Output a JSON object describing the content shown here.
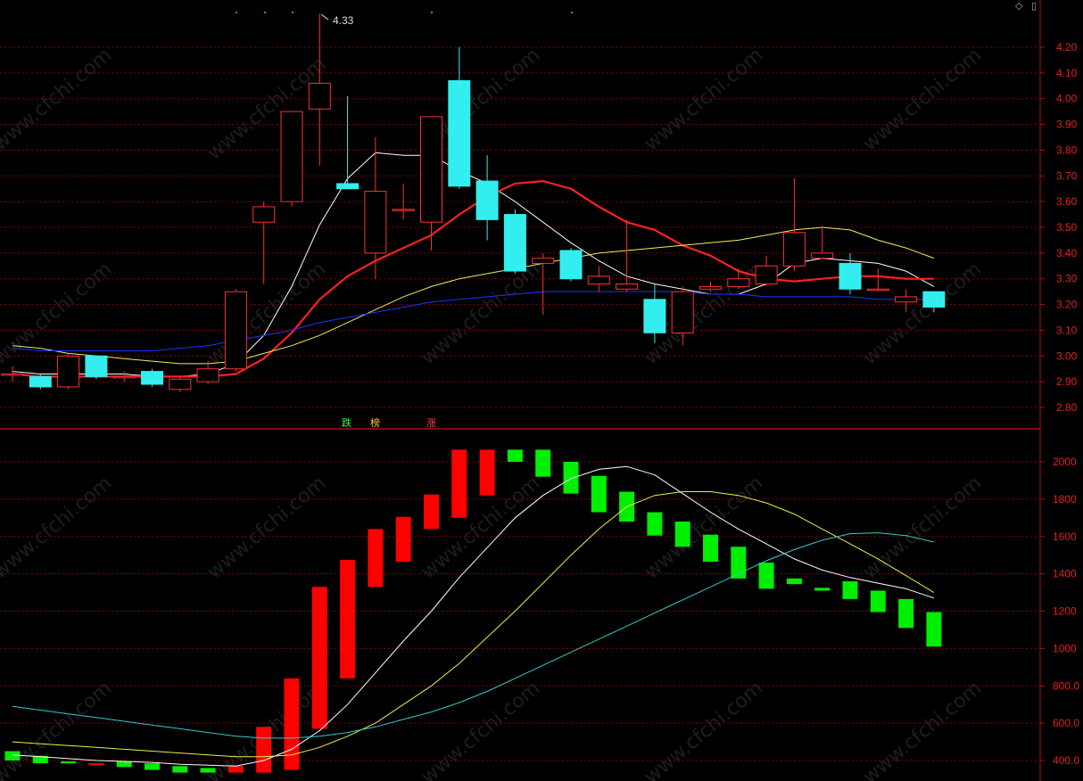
{
  "toolbar": {
    "diamond_icon": "◇",
    "window_icon": "▯"
  },
  "price_panel": {
    "peak_label": "4.33",
    "axis_ticks": [
      "4.20",
      "4.10",
      "4.00",
      "3.90",
      "3.80",
      "3.70",
      "3.60",
      "3.50",
      "3.40",
      "3.30",
      "3.20",
      "3.10",
      "3.00",
      "2.90",
      "2.80"
    ],
    "markers": [
      {
        "text": "跌",
        "color": "#33ff33"
      },
      {
        "text": "榜",
        "color": "#ffcc33"
      },
      {
        "text": "涨",
        "color": "#ff4444"
      }
    ]
  },
  "volume_panel": {
    "axis_ticks": [
      "2000",
      "1800",
      "1600",
      "1400",
      "1200",
      "1000",
      "800.0",
      "600.0",
      "400.0"
    ]
  },
  "watermark": "www.cfchi.com",
  "colors": {
    "up": "#ff3030",
    "down": "#33eeee",
    "vol_up": "#ff0000",
    "vol_down": "#00ee00",
    "ma5": "#ffffff",
    "ma10": "#ff2020",
    "ma20": "#eeee55",
    "ma60": "#2233ff",
    "vma5": "#ffffff",
    "vma10": "#eeee44",
    "vma20": "#33cccc",
    "grid": "#8b0000"
  },
  "chart_data": [
    {
      "type": "candlestick",
      "ylim": [
        2.75,
        4.33
      ],
      "candles": [
        {
          "o": 2.93,
          "h": 2.96,
          "l": 2.9,
          "c": 2.93
        },
        {
          "o": 2.92,
          "h": 2.93,
          "l": 2.87,
          "c": 2.88
        },
        {
          "o": 2.88,
          "h": 3.01,
          "l": 2.87,
          "c": 3.0
        },
        {
          "o": 3.0,
          "h": 3.0,
          "l": 2.91,
          "c": 2.92
        },
        {
          "o": 2.92,
          "h": 2.94,
          "l": 2.9,
          "c": 2.92
        },
        {
          "o": 2.94,
          "h": 2.95,
          "l": 2.88,
          "c": 2.89
        },
        {
          "o": 2.87,
          "h": 2.92,
          "l": 2.86,
          "c": 2.91
        },
        {
          "o": 2.9,
          "h": 2.98,
          "l": 2.89,
          "c": 2.95
        },
        {
          "o": 2.95,
          "h": 3.26,
          "l": 2.94,
          "c": 3.25
        },
        {
          "o": 3.52,
          "h": 3.6,
          "l": 3.28,
          "c": 3.58
        },
        {
          "o": 3.6,
          "h": 3.95,
          "l": 3.58,
          "c": 3.95
        },
        {
          "o": 3.96,
          "h": 4.33,
          "l": 3.74,
          "c": 4.06
        },
        {
          "o": 3.67,
          "h": 4.01,
          "l": 3.66,
          "c": 3.65
        },
        {
          "o": 3.4,
          "h": 3.85,
          "l": 3.3,
          "c": 3.64
        },
        {
          "o": 3.57,
          "h": 3.67,
          "l": 3.53,
          "c": 3.57
        },
        {
          "o": 3.52,
          "h": 3.93,
          "l": 3.41,
          "c": 3.93
        },
        {
          "o": 4.07,
          "h": 4.2,
          "l": 3.65,
          "c": 3.66
        },
        {
          "o": 3.68,
          "h": 3.78,
          "l": 3.45,
          "c": 3.53
        },
        {
          "o": 3.55,
          "h": 3.57,
          "l": 3.32,
          "c": 3.33
        },
        {
          "o": 3.36,
          "h": 3.4,
          "l": 3.16,
          "c": 3.38
        },
        {
          "o": 3.41,
          "h": 3.42,
          "l": 3.29,
          "c": 3.3
        },
        {
          "o": 3.28,
          "h": 3.35,
          "l": 3.25,
          "c": 3.31
        },
        {
          "o": 3.26,
          "h": 3.53,
          "l": 3.25,
          "c": 3.28
        },
        {
          "o": 3.22,
          "h": 3.28,
          "l": 3.05,
          "c": 3.09
        },
        {
          "o": 3.09,
          "h": 3.27,
          "l": 3.04,
          "c": 3.25
        },
        {
          "o": 3.26,
          "h": 3.29,
          "l": 3.25,
          "c": 3.27
        },
        {
          "o": 3.27,
          "h": 3.34,
          "l": 3.26,
          "c": 3.3
        },
        {
          "o": 3.28,
          "h": 3.39,
          "l": 3.27,
          "c": 3.35
        },
        {
          "o": 3.35,
          "h": 3.69,
          "l": 3.33,
          "c": 3.48
        },
        {
          "o": 3.38,
          "h": 3.5,
          "l": 3.38,
          "c": 3.4
        },
        {
          "o": 3.36,
          "h": 3.4,
          "l": 3.24,
          "c": 3.26
        },
        {
          "o": 3.26,
          "h": 3.34,
          "l": 3.25,
          "c": 3.26
        },
        {
          "o": 3.21,
          "h": 3.26,
          "l": 3.17,
          "c": 3.23
        },
        {
          "o": 3.25,
          "h": 3.25,
          "l": 3.17,
          "c": 3.19
        }
      ],
      "ma_lines": [
        {
          "name": "MA5",
          "values": [
            2.94,
            2.93,
            2.93,
            2.93,
            2.93,
            2.92,
            2.92,
            2.93,
            2.97,
            3.08,
            3.27,
            3.51,
            3.69,
            3.79,
            3.78,
            3.78,
            3.72,
            3.67,
            3.6,
            3.52,
            3.44,
            3.37,
            3.31,
            3.28,
            3.26,
            3.24,
            3.24,
            3.28,
            3.36,
            3.38,
            3.37,
            3.36,
            3.33,
            3.27
          ]
        },
        {
          "name": "MA10",
          "values": [
            2.93,
            2.92,
            2.92,
            2.92,
            2.92,
            2.92,
            2.92,
            2.92,
            2.93,
            2.99,
            3.09,
            3.22,
            3.31,
            3.37,
            3.42,
            3.47,
            3.55,
            3.62,
            3.67,
            3.68,
            3.65,
            3.58,
            3.52,
            3.49,
            3.43,
            3.39,
            3.33,
            3.3,
            3.29,
            3.3,
            3.31,
            3.31,
            3.3,
            3.3
          ]
        },
        {
          "name": "MA20",
          "values": [
            3.04,
            3.03,
            3.01,
            3.0,
            2.99,
            2.98,
            2.97,
            2.97,
            2.98,
            3.01,
            3.04,
            3.08,
            3.13,
            3.18,
            3.23,
            3.27,
            3.3,
            3.32,
            3.34,
            3.36,
            3.38,
            3.4,
            3.41,
            3.42,
            3.43,
            3.44,
            3.45,
            3.47,
            3.49,
            3.5,
            3.49,
            3.45,
            3.42,
            3.38
          ]
        },
        {
          "name": "MA60",
          "values": [
            3.03,
            3.02,
            3.02,
            3.02,
            3.02,
            3.02,
            3.03,
            3.04,
            3.06,
            3.08,
            3.1,
            3.13,
            3.15,
            3.17,
            3.19,
            3.21,
            3.22,
            3.23,
            3.24,
            3.25,
            3.25,
            3.25,
            3.25,
            3.25,
            3.25,
            3.24,
            3.24,
            3.23,
            3.23,
            3.23,
            3.23,
            3.22,
            3.22,
            3.22
          ]
        }
      ]
    },
    {
      "type": "bar",
      "ylim": [
        330,
        2170
      ],
      "bars": [
        {
          "lo": 400,
          "hi": 450,
          "dir": "down"
        },
        {
          "lo": 385,
          "hi": 425,
          "dir": "down"
        },
        {
          "lo": 385,
          "hi": 395,
          "dir": "down"
        },
        {
          "lo": 375,
          "hi": 385,
          "dir": "up"
        },
        {
          "lo": 365,
          "hi": 395,
          "dir": "down"
        },
        {
          "lo": 350,
          "hi": 385,
          "dir": "down"
        },
        {
          "lo": 335,
          "hi": 370,
          "dir": "down"
        },
        {
          "lo": 335,
          "hi": 360,
          "dir": "down"
        },
        {
          "lo": 335,
          "hi": 370,
          "dir": "up"
        },
        {
          "lo": 335,
          "hi": 580,
          "dir": "up"
        },
        {
          "lo": 350,
          "hi": 840,
          "dir": "up"
        },
        {
          "lo": 570,
          "hi": 1330,
          "dir": "up"
        },
        {
          "lo": 840,
          "hi": 1475,
          "dir": "up"
        },
        {
          "lo": 1330,
          "hi": 1640,
          "dir": "up"
        },
        {
          "lo": 1465,
          "hi": 1705,
          "dir": "up"
        },
        {
          "lo": 1640,
          "hi": 1825,
          "dir": "up"
        },
        {
          "lo": 1700,
          "hi": 2065,
          "dir": "up"
        },
        {
          "lo": 1820,
          "hi": 2065,
          "dir": "up"
        },
        {
          "lo": 2000,
          "hi": 2065,
          "dir": "down"
        },
        {
          "lo": 1920,
          "hi": 2065,
          "dir": "down"
        },
        {
          "lo": 1830,
          "hi": 2000,
          "dir": "down"
        },
        {
          "lo": 1730,
          "hi": 1925,
          "dir": "down"
        },
        {
          "lo": 1680,
          "hi": 1840,
          "dir": "down"
        },
        {
          "lo": 1605,
          "hi": 1730,
          "dir": "down"
        },
        {
          "lo": 1545,
          "hi": 1680,
          "dir": "down"
        },
        {
          "lo": 1465,
          "hi": 1610,
          "dir": "down"
        },
        {
          "lo": 1375,
          "hi": 1545,
          "dir": "down"
        },
        {
          "lo": 1320,
          "hi": 1460,
          "dir": "down"
        },
        {
          "lo": 1345,
          "hi": 1375,
          "dir": "down"
        },
        {
          "lo": 1310,
          "hi": 1325,
          "dir": "down"
        },
        {
          "lo": 1265,
          "hi": 1360,
          "dir": "down"
        },
        {
          "lo": 1195,
          "hi": 1310,
          "dir": "down"
        },
        {
          "lo": 1110,
          "hi": 1265,
          "dir": "down"
        },
        {
          "lo": 1010,
          "hi": 1195,
          "dir": "down"
        }
      ],
      "ma_lines": [
        {
          "name": "VMA5",
          "values": [
            430,
            420,
            410,
            400,
            395,
            390,
            380,
            375,
            370,
            400,
            460,
            560,
            700,
            870,
            1040,
            1200,
            1380,
            1540,
            1700,
            1820,
            1910,
            1960,
            1975,
            1930,
            1830,
            1730,
            1640,
            1560,
            1480,
            1420,
            1380,
            1350,
            1320,
            1270
          ]
        },
        {
          "name": "VMA10",
          "values": [
            500,
            490,
            480,
            470,
            460,
            450,
            440,
            430,
            420,
            420,
            430,
            470,
            530,
            600,
            700,
            800,
            920,
            1060,
            1200,
            1350,
            1500,
            1640,
            1760,
            1820,
            1840,
            1840,
            1820,
            1780,
            1720,
            1640,
            1560,
            1480,
            1390,
            1300
          ]
        },
        {
          "name": "VMA20",
          "values": [
            690,
            670,
            650,
            630,
            610,
            590,
            570,
            550,
            530,
            520,
            520,
            530,
            550,
            580,
            620,
            660,
            710,
            770,
            840,
            910,
            980,
            1050,
            1120,
            1190,
            1260,
            1330,
            1400,
            1470,
            1530,
            1580,
            1615,
            1620,
            1605,
            1570
          ]
        }
      ]
    }
  ]
}
